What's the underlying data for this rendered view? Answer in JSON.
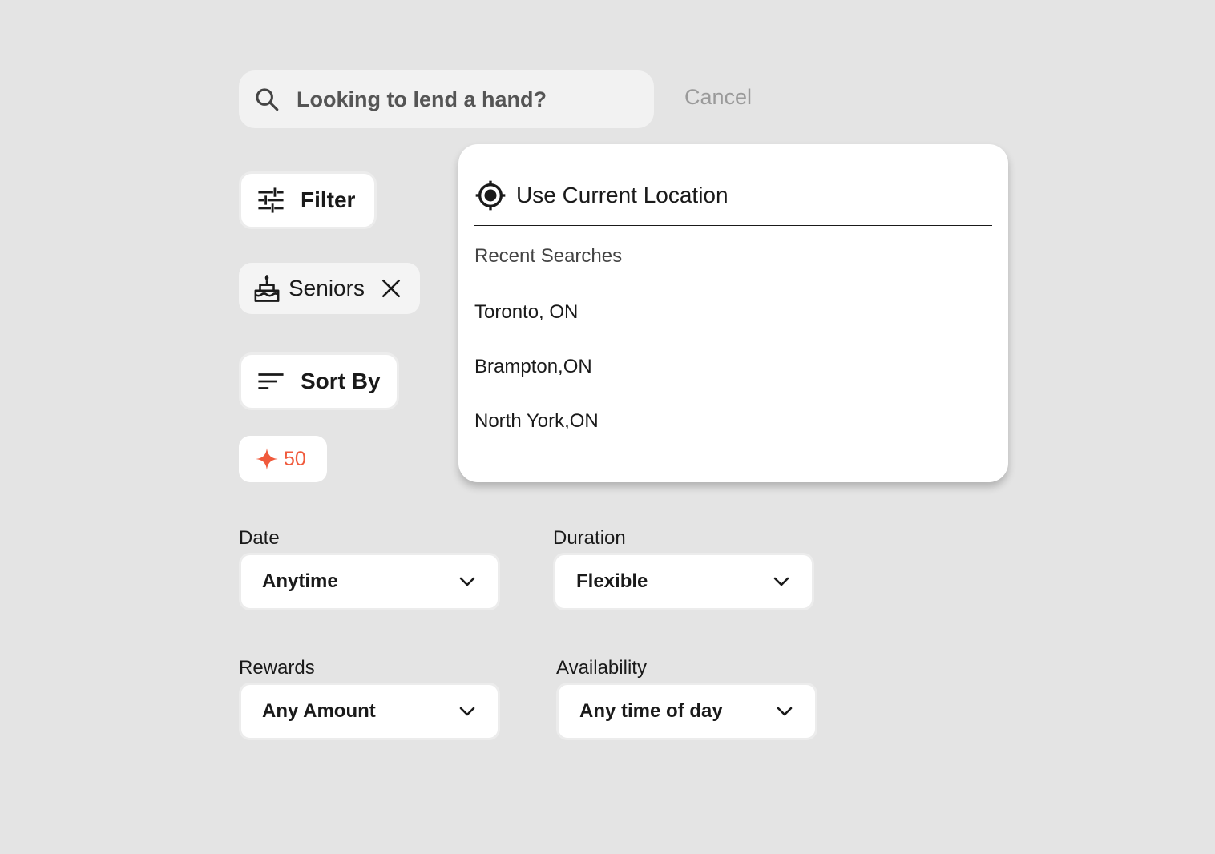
{
  "search": {
    "placeholder": "Looking to lend a hand?",
    "cancel_label": "Cancel"
  },
  "filter": {
    "label": "Filter"
  },
  "category_chip": {
    "label": "Seniors"
  },
  "sort": {
    "label": "Sort By"
  },
  "points": {
    "value": "50",
    "color": "#f05a3c"
  },
  "location_dropdown": {
    "current_location_label": "Use Current Location",
    "recent_title": "Recent Searches",
    "recent": [
      "Toronto, ON",
      "Brampton,ON",
      "North York,ON"
    ]
  },
  "fields": {
    "date": {
      "label": "Date",
      "value": "Anytime"
    },
    "duration": {
      "label": "Duration",
      "value": "Flexible"
    },
    "rewards": {
      "label": "Rewards",
      "value": "Any Amount"
    },
    "availability": {
      "label": "Availability",
      "value": "Any time of day"
    }
  }
}
